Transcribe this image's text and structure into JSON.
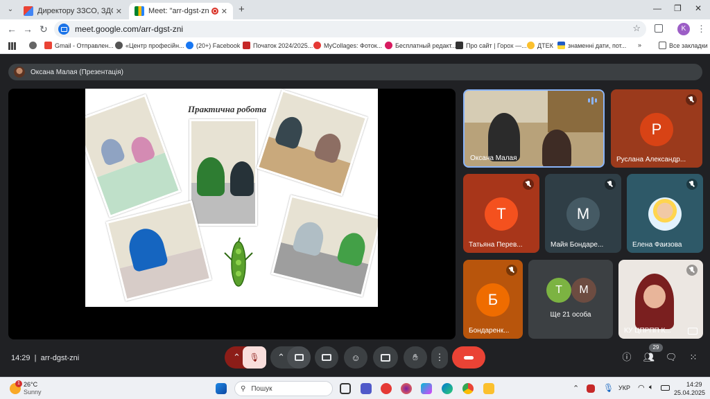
{
  "browser": {
    "tabs": [
      {
        "title": "Директору ЗЗСО, ЗДО. Запрош",
        "active": false
      },
      {
        "title": "Meet: \"arr-dgst-zni\"",
        "active": true
      }
    ],
    "url": "meet.google.com/arr-dgst-zni",
    "profile_initial": "K",
    "bookmarks": [
      {
        "label": "Gmail - Отправлен..."
      },
      {
        "label": "«Центр професійн..."
      },
      {
        "label": "(20+) Facebook"
      },
      {
        "label": "Початок 2024/2025..."
      },
      {
        "label": "MyCollages: Фоток..."
      },
      {
        "label": "Бесплатный редакт..."
      },
      {
        "label": "Про сайт | Горох —..."
      },
      {
        "label": "ДТЕК"
      },
      {
        "label": "знаменні дати, пот..."
      }
    ],
    "all_bookmarks": "Все закладки"
  },
  "meet": {
    "presenter_label": "Оксана Малая (Презентація)",
    "slide_title": "Практична робота",
    "participants": [
      {
        "name": "Оксана Малая",
        "type": "video",
        "speaking": true
      },
      {
        "name": "Руслана Александр...",
        "initial": "Р",
        "color": "#d84315",
        "muted": true
      },
      {
        "name": "Татьяна Перев...",
        "initial": "Т",
        "color": "#f4511e",
        "muted": true
      },
      {
        "name": "Майя Бондаре...",
        "initial": "М",
        "color": "#455a64",
        "muted": true
      },
      {
        "name": "Елена Фаизова",
        "type": "photo",
        "muted": true
      },
      {
        "name": "Бондаренк...",
        "initial": "Б",
        "color": "#ef6c00",
        "muted": true
      },
      {
        "name": "КУ ЦПРПП К...",
        "type": "video",
        "muted": true
      }
    ],
    "others": {
      "label": "Ще 21 особа",
      "initials": [
        "Т",
        "М"
      ],
      "colors": [
        "#7cb342",
        "#6d4c41"
      ]
    },
    "time": "14:29",
    "meeting_code": "arr-dgst-zni",
    "people_count": "29"
  },
  "taskbar": {
    "weather_temp": "26°C",
    "weather_desc": "Sunny",
    "notification_count": "1",
    "search_placeholder": "Пошук",
    "language": "УКР",
    "clock_time": "14:29",
    "clock_date": "25.04.2025"
  }
}
